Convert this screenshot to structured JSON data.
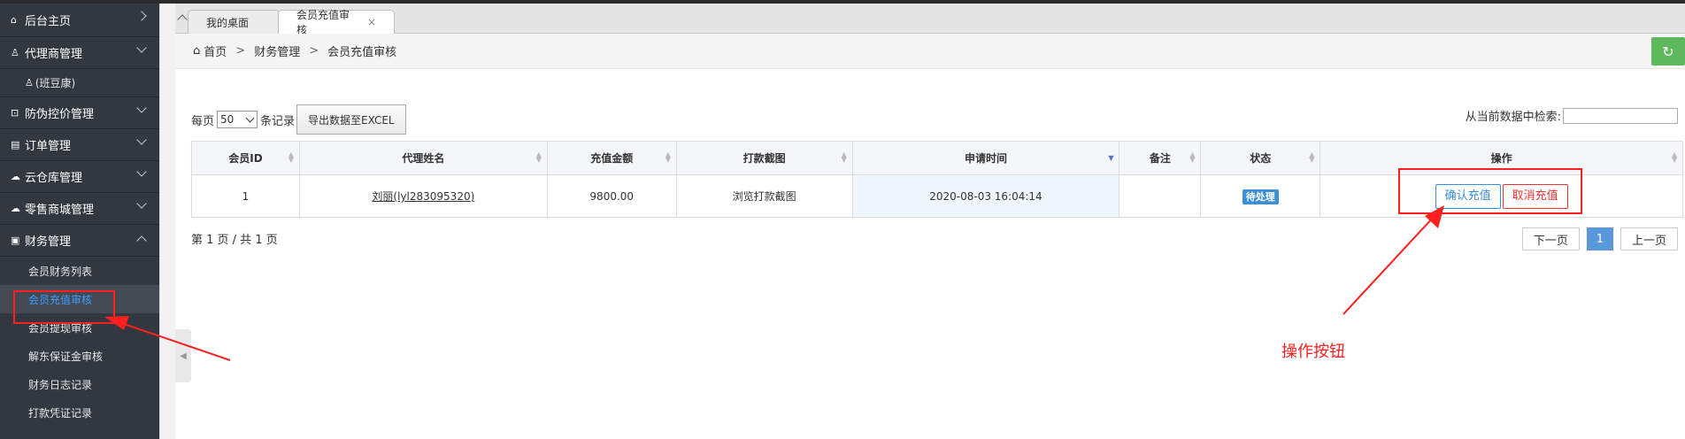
{
  "sidebar": {
    "items": [
      {
        "icon": "home-icon",
        "glyph": "⌂",
        "label": "后台主页",
        "chevron": "right"
      },
      {
        "icon": "user-icon",
        "glyph": "♙",
        "label": "代理商管理",
        "chevron": "down"
      },
      {
        "icon": "user-icon",
        "glyph": "♙",
        "label": "(班豆康)",
        "sub": true
      },
      {
        "icon": "scan-icon",
        "glyph": "⊡",
        "label": "防伪控价管理",
        "chevron": "down"
      },
      {
        "icon": "order-icon",
        "glyph": "▤",
        "label": "订单管理",
        "chevron": "down"
      },
      {
        "icon": "cloud-icon",
        "glyph": "☁",
        "label": "云仓库管理",
        "chevron": "down"
      },
      {
        "icon": "cloud-icon",
        "glyph": "☁",
        "label": "零售商城管理",
        "chevron": "down"
      },
      {
        "icon": "finance-icon",
        "glyph": "▣",
        "label": "财务管理",
        "chevron": "up"
      }
    ],
    "finance_sub": [
      {
        "label": "会员财务列表",
        "active": false
      },
      {
        "label": "会员充值审核",
        "active": true
      },
      {
        "label": "会员提现审核",
        "active": false
      },
      {
        "label": "解东保证金审核",
        "active": false
      },
      {
        "label": "财务日志记录",
        "active": false
      },
      {
        "label": "打款凭证记录",
        "active": false
      }
    ]
  },
  "tabs": [
    {
      "label": "我的桌面"
    },
    {
      "label": "会员充值审核",
      "close": "×"
    }
  ],
  "breadcrumb": {
    "home": "首页",
    "sep": ">",
    "level1": "财务管理",
    "level2": "会员充值审核"
  },
  "toolbar": {
    "per_page_prefix": "每页",
    "per_page_value": "50",
    "per_page_suffix": "条记录",
    "export_label": "导出数据至EXCEL",
    "search_label": "从当前数据中检索:"
  },
  "table": {
    "columns": [
      "会员ID",
      "代理姓名",
      "充值金额",
      "打款截图",
      "申请时间",
      "备注",
      "状态",
      "操作"
    ],
    "rows": [
      {
        "member_id": "1",
        "agent_name": "刘丽(lyl283095320)",
        "amount": "9800.00",
        "screenshot": "浏览打款截图",
        "time": "2020-08-03 16:04:14",
        "note": "",
        "status": "待处理",
        "confirm": "确认充值",
        "cancel": "取消充值"
      }
    ]
  },
  "pageinfo": "第 1 页 / 共 1 页",
  "pager": {
    "next": "下一页",
    "current": "1",
    "prev": "上一页"
  },
  "annotation": {
    "label": "操作按钮",
    "color": "#ff1f1f"
  },
  "colors": {
    "sidebar_bg": "#333840",
    "accent": "#3b8fd6",
    "danger": "#e33333",
    "refresh": "#5eb95e"
  }
}
